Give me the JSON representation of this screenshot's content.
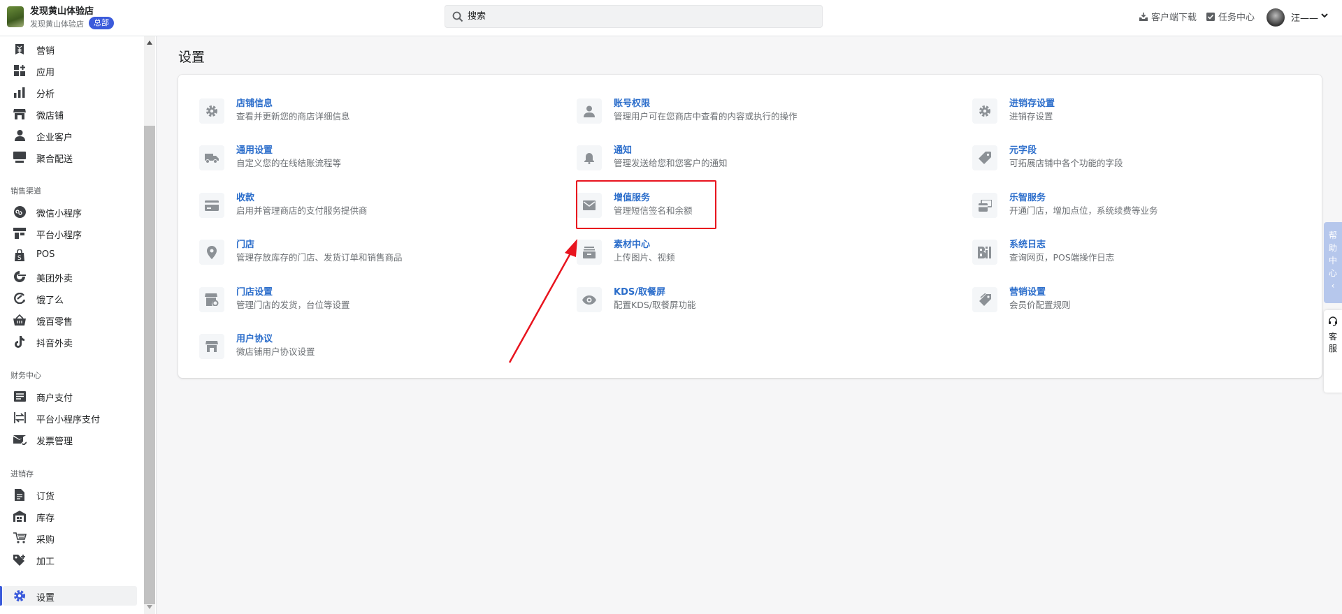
{
  "topbar": {
    "shop_name": "发现黄山体验店",
    "shop_sub": "发现黄山体验店",
    "shop_badge": "总部",
    "search_placeholder": "搜索",
    "client_download": "客户端下载",
    "task_center": "任务中心",
    "user_name": "汪——"
  },
  "sidebar": {
    "main_items": [
      {
        "label": "营销",
        "icon": "yuan-tag-icon"
      },
      {
        "label": "应用",
        "icon": "apps-grid-icon"
      },
      {
        "label": "分析",
        "icon": "bar-chart-icon"
      },
      {
        "label": "微店铺",
        "icon": "store-icon"
      },
      {
        "label": "企业客户",
        "icon": "person-icon"
      },
      {
        "label": "聚合配送",
        "icon": "monitor-icon"
      }
    ],
    "groups": [
      {
        "title": "销售渠道",
        "items": [
          {
            "label": "微信小程序",
            "icon": "mini-program-icon"
          },
          {
            "label": "平台小程序",
            "icon": "platform-icon"
          },
          {
            "label": "POS",
            "icon": "pos-bag-icon"
          },
          {
            "label": "美团外卖",
            "icon": "meituan-icon"
          },
          {
            "label": "饿了么",
            "icon": "eleme-icon"
          },
          {
            "label": "饿百零售",
            "icon": "basket-icon"
          },
          {
            "label": "抖音外卖",
            "icon": "tiktok-icon"
          }
        ]
      },
      {
        "title": "财务中心",
        "items": [
          {
            "label": "商户支付",
            "icon": "list-doc-icon"
          },
          {
            "label": "平台小程序支付",
            "icon": "transfer-icon"
          },
          {
            "label": "发票管理",
            "icon": "invoice-icon"
          }
        ]
      },
      {
        "title": "进销存",
        "items": [
          {
            "label": "订货",
            "icon": "order-doc-icon"
          },
          {
            "label": "库存",
            "icon": "warehouse-icon"
          },
          {
            "label": "采购",
            "icon": "purchase-icon"
          },
          {
            "label": "加工",
            "icon": "tag-plus-icon"
          }
        ]
      }
    ],
    "active_item": {
      "label": "设置",
      "icon": "gear-icon"
    }
  },
  "main": {
    "title": "设置",
    "settings": [
      {
        "title": "店铺信息",
        "desc": "查看并更新您的商店详细信息",
        "icon": "gear-icon"
      },
      {
        "title": "账号权限",
        "desc": "管理用户可在您商店中查看的内容或执行的操作",
        "icon": "person-icon"
      },
      {
        "title": "进销存设置",
        "desc": "进销存设置",
        "icon": "gear-icon"
      },
      {
        "title": "通用设置",
        "desc": "自定义您的在线结账流程等",
        "icon": "truck-icon"
      },
      {
        "title": "通知",
        "desc": "管理发送给您和您客户的通知",
        "icon": "bell-icon"
      },
      {
        "title": "元字段",
        "desc": "可拓展店铺中各个功能的字段",
        "icon": "tag-icon"
      },
      {
        "title": "收款",
        "desc": "启用并管理商店的支付服务提供商",
        "icon": "card-icon"
      },
      {
        "title": "增值服务",
        "desc": "管理短信签名和余额",
        "icon": "envelope-icon"
      },
      {
        "title": "乐智服务",
        "desc": "开通门店，增加点位，系统续费等业务",
        "icon": "cards-icon"
      },
      {
        "title": "门店",
        "desc": "管理存放库存的门店、发货订单和销售商品",
        "icon": "location-pin-icon"
      },
      {
        "title": "素材中心",
        "desc": "上传图片、视频",
        "icon": "archive-icon"
      },
      {
        "title": "系统日志",
        "desc": "查询网页，POS端操作日志",
        "icon": "log-icon"
      },
      {
        "title": "门店设置",
        "desc": "管理门店的发货，台位等设置",
        "icon": "store-gear-icon"
      },
      {
        "title": "KDS/取餐屏",
        "desc": "配置KDS/取餐屏功能",
        "icon": "eye-icon"
      },
      {
        "title": "营销设置",
        "desc": "会员价配置规则",
        "icon": "tags-icon"
      },
      {
        "title": "用户协议",
        "desc": "微店铺用户协议设置",
        "icon": "storefront-icon"
      }
    ]
  },
  "floating": {
    "help": "帮助中心",
    "service": "客服"
  },
  "colors": {
    "accent": "#3b5bdb",
    "link": "#2c6ecb",
    "highlight": "#e8141e"
  }
}
